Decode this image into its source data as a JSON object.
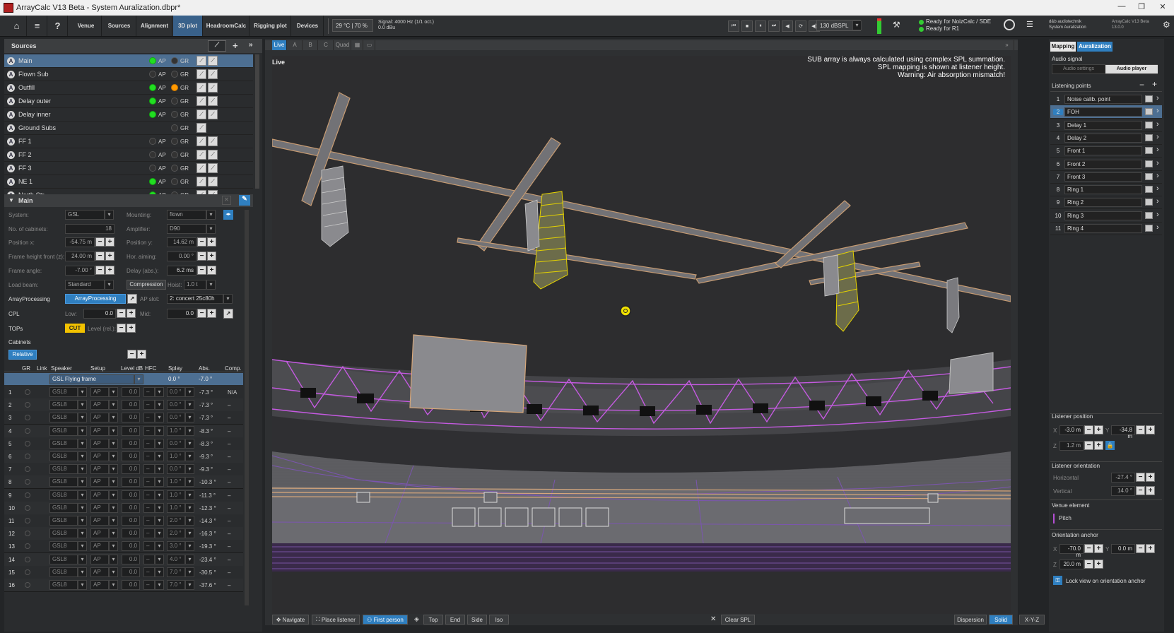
{
  "titlebar": {
    "title": "ArrayCalc V13 Beta - System Auralization.dbpr*",
    "minimize": "—",
    "maximize": "❐",
    "close": "✕"
  },
  "menubar": {
    "home": "⌂",
    "menu": "≡",
    "help": "?",
    "tabs": [
      "Venue",
      "Sources",
      "Alignment",
      "3D plot",
      "HeadroomCalc",
      "Rigging plot",
      "Devices"
    ],
    "active_tab": "3D plot",
    "temp": "29 °C | 70 %",
    "signal_line1": "Signal: 4000 Hz (1/1 oct.)",
    "signal_line2": "0.0 dBu",
    "transport": [
      "⏮",
      "■",
      "⏸",
      "⏭",
      "◀",
      "⟳",
      "◀)"
    ],
    "level": "130 dBSPL",
    "status1": "Ready for NoizCalc / SDE",
    "status2": "Ready for R1",
    "brand1": "d&b audiotechnik",
    "brand2": "System Auralization",
    "version1": "ArrayCalc V13 Beta",
    "version2": "13.0.0"
  },
  "sources": {
    "header": "Sources",
    "items": [
      {
        "name": "Main",
        "ap": "on",
        "gr": "off",
        "selected": true
      },
      {
        "name": "Flown Sub",
        "ap": "none",
        "gr": "none"
      },
      {
        "name": "Outfill",
        "ap": "on",
        "gr": "orange"
      },
      {
        "name": "Delay outer",
        "ap": "on",
        "gr": "none"
      },
      {
        "name": "Delay inner",
        "ap": "on",
        "gr": "none"
      },
      {
        "name": "Ground Subs",
        "ap": "hide",
        "gr": "none"
      },
      {
        "name": "FF 1",
        "ap": "none",
        "gr": "none"
      },
      {
        "name": "FF 2",
        "ap": "none",
        "gr": "none"
      },
      {
        "name": "FF 3",
        "ap": "none",
        "gr": "none"
      },
      {
        "name": "NE 1",
        "ap": "on",
        "gr": "none"
      },
      {
        "name": "North Ctr",
        "ap": "on",
        "gr": "none"
      }
    ],
    "ap_label": "AP",
    "gr_label": "GR"
  },
  "main": {
    "header": "Main",
    "system_label": "System:",
    "system": "GSL",
    "mounting_label": "Mounting:",
    "mounting": "flown",
    "cabinets_label": "No. of cabinets:",
    "cabinets": "18",
    "amplifier_label": "Amplifier:",
    "amplifier": "D90",
    "posx_label": "Position x:",
    "posx": "-54.75 m",
    "posy_label": "Position y:",
    "posy": "14.62 m",
    "fh_label": "Frame height front (z):",
    "fh": "24.00 m",
    "haim_label": "Hor. aiming:",
    "haim": "0.00 °",
    "fa_label": "Frame angle:",
    "fa": "-7.00 °",
    "delay_label": "Delay (abs.):",
    "delay": "6.2 ms",
    "lb_label": "Load beam:",
    "lb": "Standard",
    "compression": "Compression",
    "hoist_label": "Hoist:",
    "hoist": "1.0 t",
    "ap_label": "ArrayProcessing",
    "ap_btn": "ArrayProcessing",
    "apslot_label": "AP slot:",
    "apslot": "2: concert 25c80h",
    "cpl_label": "CPL",
    "low_label": "Low:",
    "low": "0.0",
    "mid_label": "Mid:",
    "mid": "0.0",
    "tops_label": "TOPs",
    "cut": "CUT",
    "level_rel": "Level (rel.):",
    "cabinets_header": "Cabinets",
    "relative": "Relative"
  },
  "cab_table": {
    "headers": [
      "GR",
      "Link",
      "Speaker",
      "Setup",
      "Level dB",
      "HFC",
      "Splay",
      "Abs.",
      "Comp."
    ],
    "frame": {
      "speaker": "GSL Flying frame",
      "splay": "0.0 °",
      "abs": "-7.0 °"
    },
    "rows": [
      {
        "n": "1",
        "spk": "GSL8",
        "setup": "AP",
        "lvl": "0.0",
        "hfc": "–",
        "splay": "0.0 °",
        "abs": "-7.3 °",
        "comp": "N/A"
      },
      {
        "n": "2",
        "spk": "GSL8",
        "setup": "AP",
        "lvl": "0.0",
        "hfc": "–",
        "splay": "0.0 °",
        "abs": "-7.3 °",
        "comp": "–"
      },
      {
        "n": "3",
        "spk": "GSL8",
        "setup": "AP",
        "lvl": "0.0",
        "hfc": "–",
        "splay": "0.0 °",
        "abs": "-7.3 °",
        "comp": "–"
      },
      {
        "n": "4",
        "spk": "GSL8",
        "setup": "AP",
        "lvl": "0.0",
        "hfc": "–",
        "splay": "1.0 °",
        "abs": "-8.3 °",
        "comp": "–"
      },
      {
        "n": "5",
        "spk": "GSL8",
        "setup": "AP",
        "lvl": "0.0",
        "hfc": "–",
        "splay": "0.0 °",
        "abs": "-8.3 °",
        "comp": "–"
      },
      {
        "n": "6",
        "spk": "GSL8",
        "setup": "AP",
        "lvl": "0.0",
        "hfc": "–",
        "splay": "1.0 °",
        "abs": "-9.3 °",
        "comp": "–"
      },
      {
        "n": "7",
        "spk": "GSL8",
        "setup": "AP",
        "lvl": "0.0",
        "hfc": "–",
        "splay": "0.0 °",
        "abs": "-9.3 °",
        "comp": "–"
      },
      {
        "n": "8",
        "spk": "GSL8",
        "setup": "AP",
        "lvl": "0.0",
        "hfc": "–",
        "splay": "1.0 °",
        "abs": "-10.3 °",
        "comp": "–"
      },
      {
        "n": "9",
        "spk": "GSL8",
        "setup": "AP",
        "lvl": "0.0",
        "hfc": "–",
        "splay": "1.0 °",
        "abs": "-11.3 °",
        "comp": "–"
      },
      {
        "n": "10",
        "spk": "GSL8",
        "setup": "AP",
        "lvl": "0.0",
        "hfc": "–",
        "splay": "1.0 °",
        "abs": "-12.3 °",
        "comp": "–"
      },
      {
        "n": "11",
        "spk": "GSL8",
        "setup": "AP",
        "lvl": "0.0",
        "hfc": "–",
        "splay": "2.0 °",
        "abs": "-14.3 °",
        "comp": "–"
      },
      {
        "n": "12",
        "spk": "GSL8",
        "setup": "AP",
        "lvl": "0.0",
        "hfc": "–",
        "splay": "2.0 °",
        "abs": "-16.3 °",
        "comp": "–"
      },
      {
        "n": "13",
        "spk": "GSL8",
        "setup": "AP",
        "lvl": "0.0",
        "hfc": "–",
        "splay": "3.0 °",
        "abs": "-19.3 °",
        "comp": "–"
      },
      {
        "n": "14",
        "spk": "GSL8",
        "setup": "AP",
        "lvl": "0.0",
        "hfc": "–",
        "splay": "4.0 °",
        "abs": "-23.4 °",
        "comp": "–"
      },
      {
        "n": "15",
        "spk": "GSL8",
        "setup": "AP",
        "lvl": "0.0",
        "hfc": "–",
        "splay": "7.0 °",
        "abs": "-30.5 °",
        "comp": "–"
      },
      {
        "n": "16",
        "spk": "GSL8",
        "setup": "AP",
        "lvl": "0.0",
        "hfc": "–",
        "splay": "7.0 °",
        "abs": "-37.6 °",
        "comp": "–"
      }
    ]
  },
  "viewport": {
    "tabs": [
      "Live",
      "A",
      "B",
      "C",
      "Quad"
    ],
    "live_label": "Live",
    "msg1": "SUB array is always calculated using complex SPL summation.",
    "msg2": "SPL mapping is shown at listener height.",
    "msg3": "Warning: Air absorption mismatch!",
    "nav": "Navigate",
    "place": "Place listener",
    "first": "First person",
    "views": [
      "Top",
      "End",
      "Side",
      "Iso"
    ],
    "clear": "Clear SPL",
    "dispersion": "Dispersion",
    "solid": "Solid",
    "xyz": "X-Y-Z"
  },
  "right": {
    "tabs": [
      "Mapping",
      "Auralization"
    ],
    "audio_signal": "Audio signal",
    "audio_settings": "Audio settings",
    "audio_player": "Audio player",
    "listening_points": "Listening points",
    "points": [
      {
        "n": "1",
        "name": "Noise calib. point"
      },
      {
        "n": "2",
        "name": "FOH",
        "selected": true
      },
      {
        "n": "3",
        "name": "Delay 1"
      },
      {
        "n": "4",
        "name": "Delay 2"
      },
      {
        "n": "5",
        "name": "Front 1"
      },
      {
        "n": "6",
        "name": "Front 2"
      },
      {
        "n": "7",
        "name": "Front 3"
      },
      {
        "n": "8",
        "name": "Ring 1"
      },
      {
        "n": "9",
        "name": "Ring 2"
      },
      {
        "n": "10",
        "name": "Ring 3"
      },
      {
        "n": "11",
        "name": "Ring 4"
      }
    ],
    "listener_position": "Listener position",
    "lx": "-3.0 m",
    "ly": "-34.8 m",
    "lz": "1.2 m",
    "listener_orientation": "Listener orientation",
    "horizontal_label": "Horizontal",
    "horizontal": "-27.4 °",
    "vertical_label": "Vertical",
    "vertical": "14.0 °",
    "venue_element": "Venue element",
    "pitch": "Pitch",
    "orientation_anchor": "Orientation anchor",
    "ax": "-70.0 m",
    "ay": "0.0 m",
    "az": "20.0 m",
    "lock": "Lock view on orientation anchor"
  },
  "colors": {
    "accent": "#2f7fc0",
    "selected": "#4d6f92",
    "magenta": "#b64fd6",
    "yellow": "#e4d200",
    "tan": "#d7a77a"
  }
}
